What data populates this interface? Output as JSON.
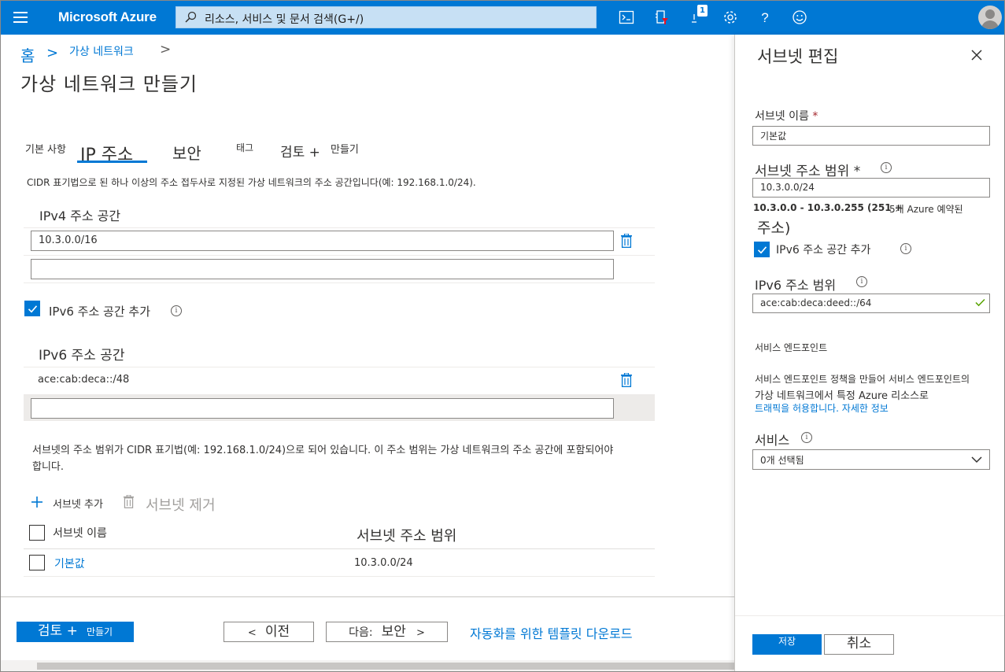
{
  "topbar": {
    "brand": "Microsoft Azure",
    "search_placeholder": "리소스, 서비스 및 문서 검색(G+/)",
    "notification_count": "1",
    "accent": "#0078d4",
    "icons": [
      "menu-icon",
      "search-icon",
      "cloud-shell-icon",
      "directory-filter-icon",
      "notifications-icon",
      "settings-icon",
      "help-icon",
      "feedback-icon",
      "avatar"
    ]
  },
  "breadcrumb": {
    "home": "홈",
    "sep1": ">",
    "vnet": "가상 네트워크",
    "sep2": ">"
  },
  "page": {
    "title": "가상 네트워크 만들기"
  },
  "tabs": {
    "basics": "기본 사항",
    "ip": "IP 주소",
    "security": "보안",
    "tags": "태그",
    "review": "검토 +",
    "create": "만들기"
  },
  "ip_tab": {
    "description": "CIDR 표기법으로 된 하나 이상의 주소 접두사로 지정된 가상 네트워크의 주소 공간입니다(예: 192.168.1.0/24).",
    "ipv4_label": "IPv4 주소 공간",
    "ipv4_values": [
      "10.3.0.0/16",
      ""
    ],
    "ipv6_checkbox_label": "IPv6 주소 공간 추가",
    "ipv6_checked": true,
    "ipv6_label": "IPv6 주소 공간",
    "ipv6_values": [
      "ace:cab:deca::/48",
      ""
    ],
    "subnet_note_line1": "서브넷의 주소 범위가 CIDR 표기법(예: 192.168.1.0/24)으로 되어 있습니다. 이 주소 범위는 가상 네트워크의 주소 공간에 포함되어야",
    "subnet_note_line2": "합니다.",
    "add_subnet": "서브넷 추가",
    "remove_subnet": "서브넷 제거",
    "table_headers": [
      "서브넷 이름",
      "서브넷 주소 범위"
    ],
    "subnets": [
      {
        "name": "기본값",
        "range": "10.3.0.0/24"
      }
    ]
  },
  "footer": {
    "review_create_a": "검토 +",
    "review_create_b": "만들기",
    "prev_a": "<",
    "prev_b": "이전",
    "next_a": "다음:",
    "next_b": "보안",
    "next_c": ">",
    "template_link": "자동화를 위한 템플릿 다운로드"
  },
  "panel": {
    "title": "서브넷 편집",
    "name_label": "서브넷 이름",
    "name_value": "기본값",
    "range_label": "서브넷 주소 범위 *",
    "range_value": "10.3.0.0/24",
    "range_info_a": "10.3.0.0 - 10.3.0.255 (251 +",
    "range_info_b": "5개 Azure 예약된",
    "range_info_c": "주소)",
    "ipv6_checkbox_label": "IPv6 주소 공간 추가",
    "ipv6_checked": true,
    "ipv6_range_label": "IPv6 주소 범위",
    "ipv6_range_value": "ace:cab:deca:deed::/64",
    "service_endpoints_title": "서비스 엔드포인트",
    "se_desc_line1": "서비스 엔드포인트 정책을 만들어 서비스 엔드포인트의",
    "se_desc_line2": "가상 네트워크에서 특정 Azure 리소스로",
    "se_desc_line3": "트래픽을 허용합니다. 자세한 정보",
    "services_label": "서비스",
    "services_value": "0개 선택됨",
    "save": "저장",
    "cancel": "취소"
  }
}
